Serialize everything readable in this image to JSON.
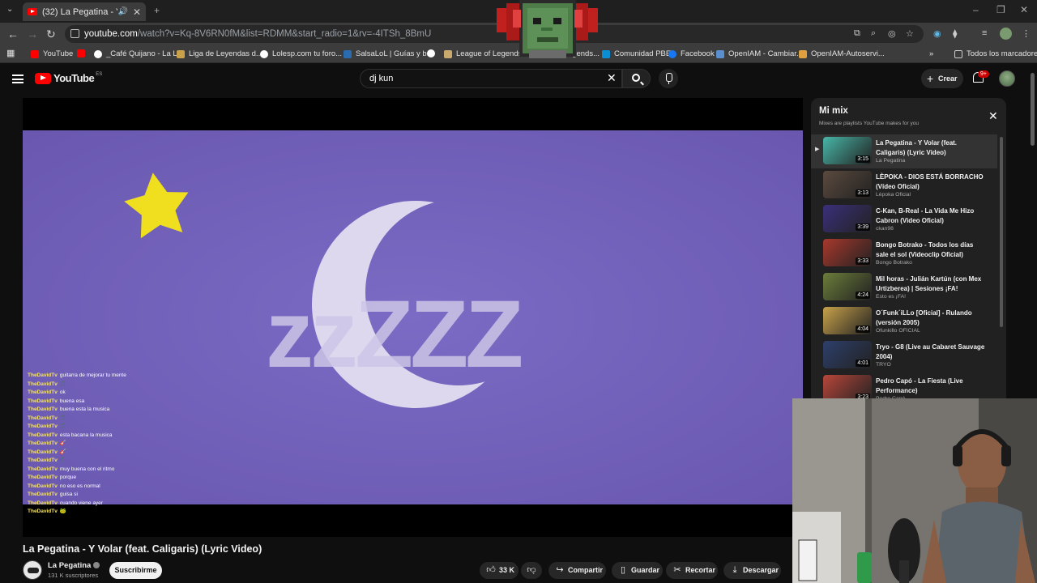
{
  "browser": {
    "tab_title": "(32) La Pegatina - Y Volar (f...",
    "url_host": "youtube.com",
    "url_path": "/watch?v=Kq-8V6RN0fM&list=RDMM&start_radio=1&rv=-4ITSh_8BmU",
    "bookmarks": [
      {
        "label": "YouTube",
        "color": "#ff0000"
      },
      {
        "label": "_Café Quijano - La L...",
        "color": "#ffffff"
      },
      {
        "label": "Liga de Leyendas d...",
        "color": "#c9a14a"
      },
      {
        "label": "Lolesp.com tu foro...",
        "color": "#ffffff"
      },
      {
        "label": "SalsaLoL | Guías y b...",
        "color": "#2b6cb0"
      },
      {
        "label": "",
        "color": "#ffffff"
      },
      {
        "label": "League of Legends",
        "color": "#c8aa6e"
      },
      {
        "label": "...egends...",
        "color": "#c8aa6e"
      },
      {
        "label": "Comunidad PBE",
        "color": "#0b8fd4"
      },
      {
        "label": "Facebook",
        "color": "#1877f2"
      },
      {
        "label": "OpenIAM - Cambiar...",
        "color": "#5a8fcf"
      },
      {
        "label": "OpenIAM-Autoservi...",
        "color": "#e0a040"
      },
      {
        "label": "Todos los marcadores",
        "color": "#cccccc"
      }
    ]
  },
  "youtube": {
    "logo_text": "YouTube",
    "country": "ES",
    "search_value": "dj kun",
    "create_label": "Crear",
    "notif_count": "9+"
  },
  "video": {
    "title": "La Pegatina - Y Volar (feat. Caligaris) (Lyric Video)",
    "overlay_text": "zzZZZ",
    "channel": "La Pegatina",
    "subscribers": "131 K suscriptores",
    "subscribe_label": "Suscribirme",
    "likes": "33 K",
    "share_label": "Compartir",
    "save_label": "Guardar",
    "clip_label": "Recortar",
    "download_label": "Descargar"
  },
  "chat": [
    {
      "user": "TheDavidTv",
      "msg": "guitarra de mejorar tu mente"
    },
    {
      "user": "TheDavidTv",
      "msg": "🎵"
    },
    {
      "user": "TheDavidTv",
      "msg": "ok"
    },
    {
      "user": "TheDavidTv",
      "msg": "buena esa"
    },
    {
      "user": "TheDavidTv",
      "msg": "buena esta la musica"
    },
    {
      "user": "TheDavidTv",
      "msg": "🎵"
    },
    {
      "user": "TheDavidTv",
      "msg": "🎵"
    },
    {
      "user": "TheDavidTv",
      "msg": "esta bacana la musica"
    },
    {
      "user": "TheDavidTv",
      "msg": "🎸"
    },
    {
      "user": "TheDavidTv",
      "msg": "🎸"
    },
    {
      "user": "TheDavidTv",
      "msg": "🎵"
    },
    {
      "user": "TheDavidTv",
      "msg": "muy buena con el ritmo"
    },
    {
      "user": "TheDavidTv",
      "msg": "porque"
    },
    {
      "user": "TheDavidTv",
      "msg": "no eso es normal"
    },
    {
      "user": "TheDavidTv",
      "msg": "guisa si"
    },
    {
      "user": "TheDavidTv",
      "msg": "cuando viene ayer"
    },
    {
      "user": "TheDavidTv",
      "msg": "🐸"
    }
  ],
  "mix": {
    "title": "Mi mix",
    "subtitle": "Mixes are playlists YouTube makes for you",
    "items": [
      {
        "title": "La Pegatina - Y Volar (feat. Caligaris) (Lyric Video)",
        "channel": "La Pegatina",
        "duration": "3:15",
        "thumb": "#48b7a8",
        "active": true
      },
      {
        "title": "LÈPOKA - DIOS ESTÁ BORRACHO (Vídeo Oficial)",
        "channel": "Lèpoka Oficial",
        "duration": "3:13",
        "thumb": "#5b4a3e",
        "active": false
      },
      {
        "title": "C-Kan, B-Real - La Vida Me Hizo Cabron (Video Oficial)",
        "channel": "ckan98",
        "duration": "3:39",
        "thumb": "#3a2f7a",
        "active": false
      },
      {
        "title": "Bongo Botrako - Todos los días sale el sol (Videoclip Oficial)",
        "channel": "Bongo Botrako",
        "duration": "3:33",
        "thumb": "#a8382c",
        "active": false
      },
      {
        "title": "Mil horas - Julián Kartún (con Mex Urtizberea) | Sesiones ¡FA!",
        "channel": "Esto es ¡FA!",
        "duration": "4:24",
        "thumb": "#6b7d3a",
        "active": false
      },
      {
        "title": "O´Funk´iLLo [Oficial] - Rulando (versión 2005)",
        "channel": "Ofunkillo OFICIAL",
        "duration": "4:04",
        "thumb": "#c8a24a",
        "active": false
      },
      {
        "title": "Tryo - G8 (Live au Cabaret Sauvage 2004)",
        "channel": "TRYO",
        "duration": "4:01",
        "thumb": "#2d3f6b",
        "active": false
      },
      {
        "title": "Pedro Capó - La Fiesta (Live Performance)",
        "channel": "Pedro Capó",
        "duration": "3:23",
        "thumb": "#b8463a",
        "active": false
      }
    ]
  }
}
